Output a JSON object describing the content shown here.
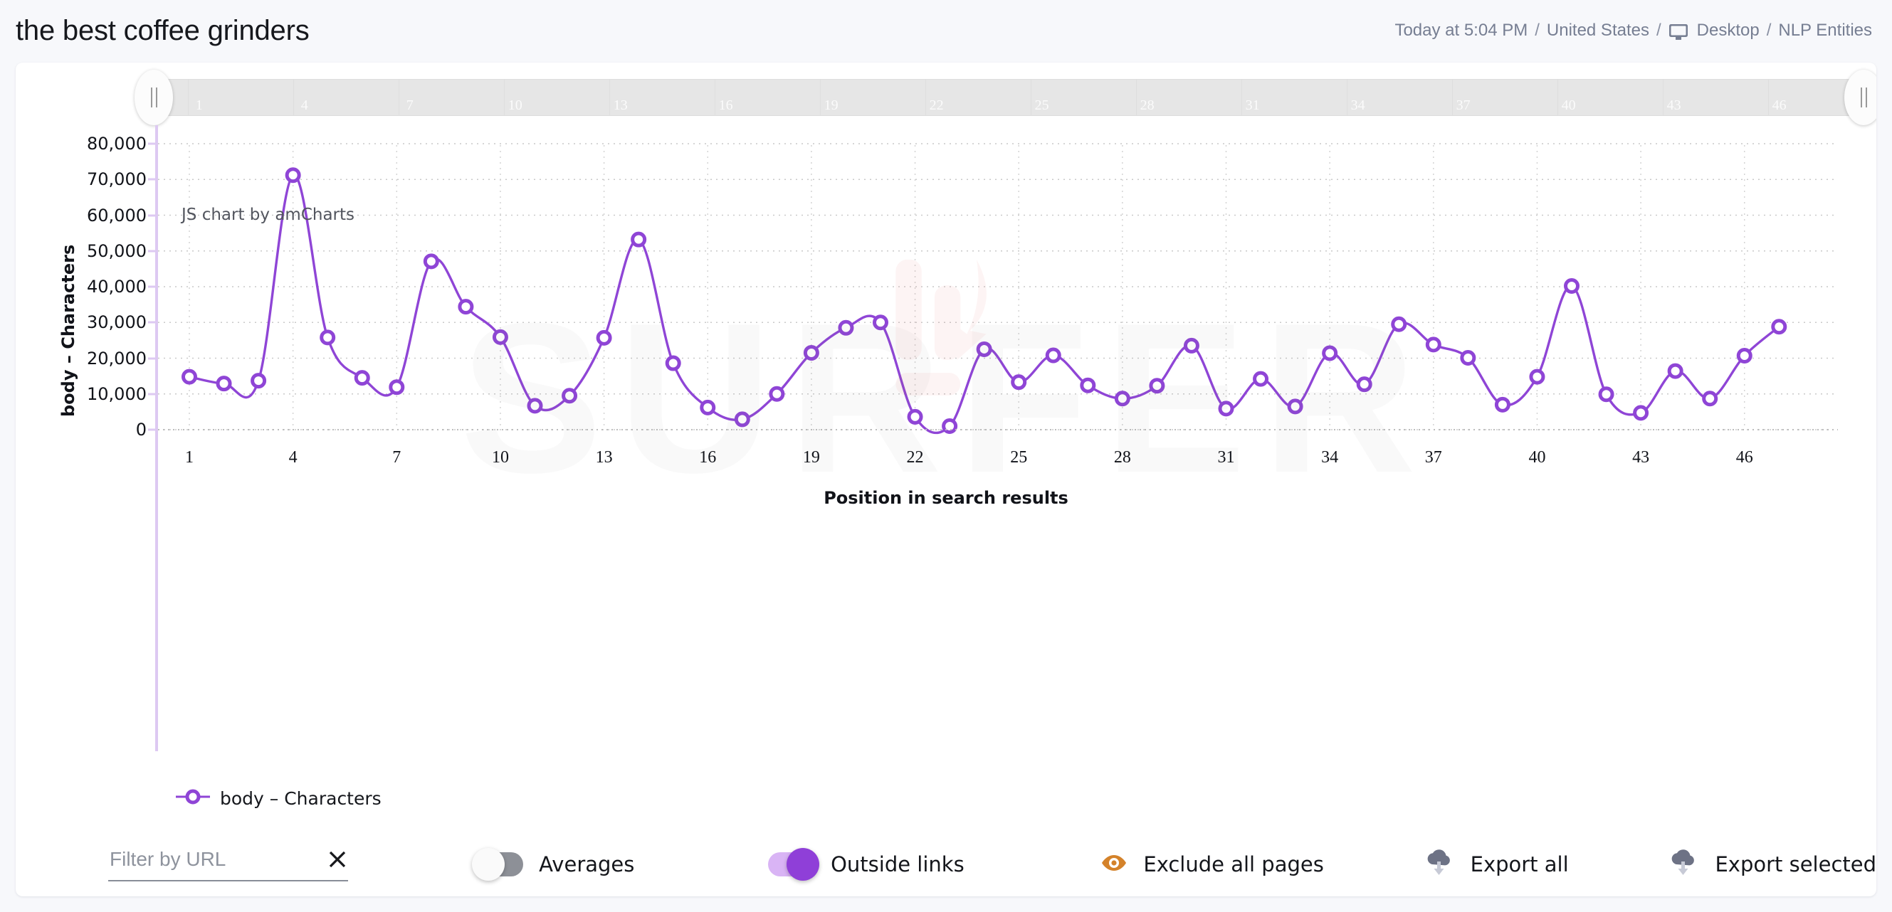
{
  "header": {
    "title": "the best coffee grinders",
    "timestamp": "Today at 5:04 PM",
    "country": "United States",
    "device": "Desktop",
    "mode": "NLP Entities",
    "separator": "/",
    "device_icon": "monitor-icon"
  },
  "chart": {
    "credit": "JS chart by amCharts",
    "watermark": "SURFER",
    "legend": [
      {
        "label": "body – Characters",
        "color": "#8f45d6"
      }
    ],
    "scrollbar": {
      "grip_left_icon": "drag-handle-icon",
      "grip_right_icon": "drag-handle-icon",
      "ticks": [
        "1",
        "4",
        "7",
        "10",
        "13",
        "16",
        "19",
        "22",
        "25",
        "28",
        "31",
        "34",
        "37",
        "40",
        "43",
        "46"
      ]
    }
  },
  "chart_data": {
    "type": "line",
    "title": "",
    "subtitle": "",
    "xlabel": "Position in search results",
    "ylabel": "body – Characters",
    "xlim": [
      1,
      48
    ],
    "ylim": [
      0,
      80000
    ],
    "ytick_labels": [
      "80,000",
      "70,000",
      "60,000",
      "50,000",
      "40,000",
      "30,000",
      "20,000",
      "10,000",
      "0"
    ],
    "ytick_values": [
      80000,
      70000,
      60000,
      50000,
      40000,
      30000,
      20000,
      10000,
      0
    ],
    "xtick_labels": [
      "1",
      "4",
      "7",
      "10",
      "13",
      "16",
      "19",
      "22",
      "25",
      "28",
      "31",
      "34",
      "37",
      "40",
      "43",
      "46"
    ],
    "xtick_values": [
      1,
      4,
      7,
      10,
      13,
      16,
      19,
      22,
      25,
      28,
      31,
      34,
      37,
      40,
      43,
      46
    ],
    "grid": true,
    "legend_position": "bottom-left",
    "line_color": "#8f45d6",
    "marker": "hollow-circle",
    "series": [
      {
        "name": "body – Characters",
        "x": [
          1,
          2,
          3,
          4,
          5,
          6,
          7,
          8,
          9,
          10,
          11,
          12,
          13,
          14,
          15,
          16,
          17,
          18,
          19,
          20,
          21,
          22,
          23,
          24,
          25,
          26,
          27,
          28,
          29,
          30,
          31,
          32,
          33,
          34,
          35,
          36,
          37,
          38,
          39,
          40,
          41,
          42,
          43,
          44,
          45,
          46,
          47
        ],
        "values": [
          14800,
          12900,
          13700,
          71200,
          25800,
          14500,
          11900,
          47100,
          34400,
          25900,
          6700,
          9500,
          25700,
          53200,
          18600,
          6200,
          2900,
          10000,
          21500,
          28500,
          30000,
          3600,
          1000,
          22500,
          13300,
          20800,
          12400,
          8700,
          12300,
          23500,
          5900,
          14200,
          6500,
          21400,
          12700,
          29500,
          23800,
          20100,
          7000,
          14800,
          40200,
          9900,
          4700,
          16400,
          8700,
          20700,
          28800
        ]
      }
    ]
  },
  "toolbar": {
    "filter_placeholder": "Filter by URL",
    "filter_value": "",
    "clear_icon": "close-icon",
    "averages_label": "Averages",
    "averages_on": false,
    "outside_links_label": "Outside links",
    "outside_links_on": true,
    "exclude_label": "Exclude all pages",
    "exclude_icon": "eye-icon",
    "exclude_icon_color": "#d4822a",
    "export_all_label": "Export all",
    "export_selected_label": "Export selected",
    "export_icon": "cloud-download-icon"
  }
}
